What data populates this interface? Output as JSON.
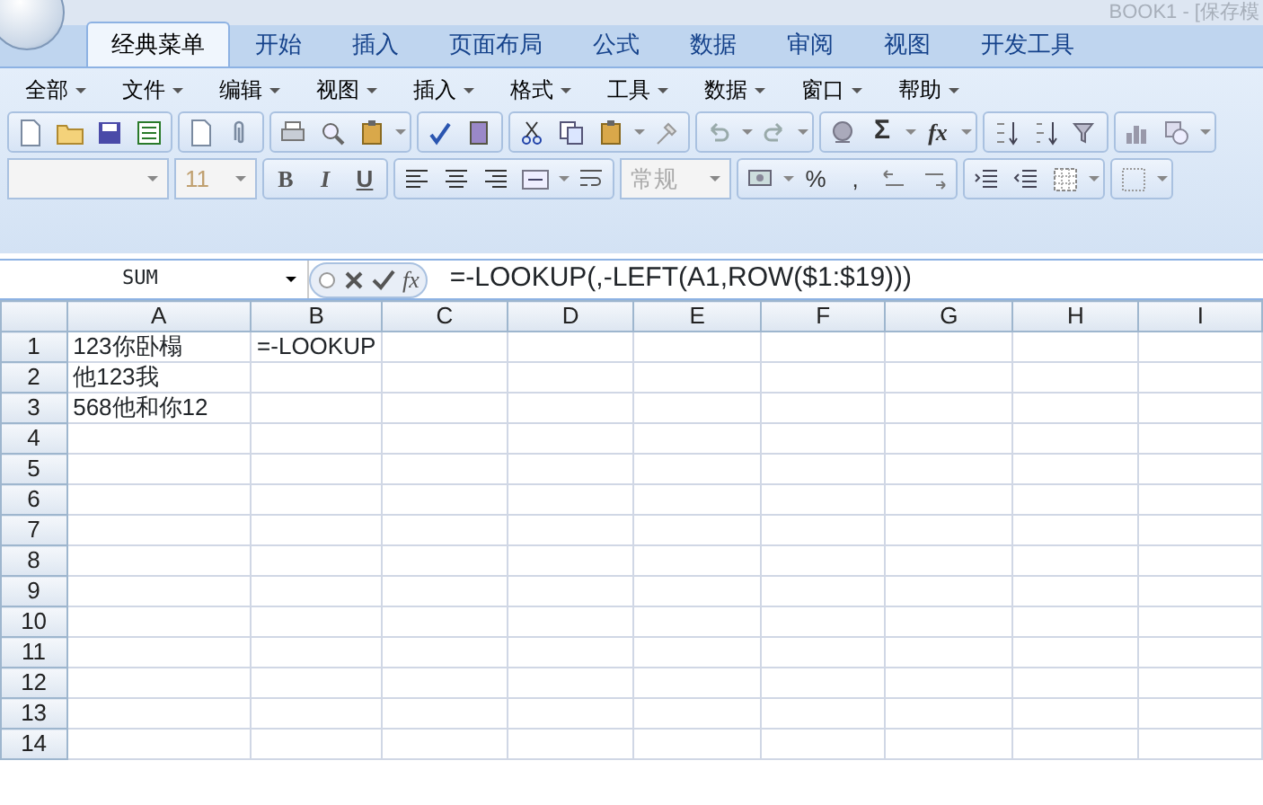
{
  "window": {
    "title": "BOOK1 - [保存模"
  },
  "tabs": [
    {
      "label": "经典菜单",
      "selected": true
    },
    {
      "label": "开始",
      "selected": false
    },
    {
      "label": "插入",
      "selected": false
    },
    {
      "label": "页面布局",
      "selected": false
    },
    {
      "label": "公式",
      "selected": false
    },
    {
      "label": "数据",
      "selected": false
    },
    {
      "label": "审阅",
      "selected": false
    },
    {
      "label": "视图",
      "selected": false
    },
    {
      "label": "开发工具",
      "selected": false
    }
  ],
  "menu": [
    "全部",
    "文件",
    "编辑",
    "视图",
    "插入",
    "格式",
    "工具",
    "数据",
    "窗口",
    "帮助"
  ],
  "toolbar": {
    "sum": "Σ",
    "function": "fx",
    "font_size": "11",
    "style_buttons": [
      "B",
      "I",
      "U"
    ],
    "number_format": "常规",
    "number_buttons": [
      "%",
      ","
    ]
  },
  "formula_bar": {
    "name_box": "SUM",
    "function_label": "fx",
    "formula": "=-LOOKUP(,-LEFT(A1,ROW($1:$19)))"
  },
  "sheet": {
    "columns": [
      "A",
      "B",
      "C",
      "D",
      "E",
      "F",
      "G",
      "H",
      "I"
    ],
    "rows": [
      {
        "header": "1",
        "cells": [
          "123你卧榻",
          "=-LOOKUP"
        ]
      },
      {
        "header": "2",
        "cells": [
          "他123我"
        ]
      },
      {
        "header": "3",
        "cells": [
          "568他和你12"
        ]
      },
      {
        "header": "4",
        "cells": []
      },
      {
        "header": "5",
        "cells": []
      },
      {
        "header": "6",
        "cells": []
      },
      {
        "header": "7",
        "cells": []
      },
      {
        "header": "8",
        "cells": []
      },
      {
        "header": "9",
        "cells": []
      },
      {
        "header": "10",
        "cells": []
      },
      {
        "header": "11",
        "cells": []
      },
      {
        "header": "12",
        "cells": []
      },
      {
        "header": "13",
        "cells": []
      },
      {
        "header": "14",
        "cells": []
      }
    ]
  }
}
